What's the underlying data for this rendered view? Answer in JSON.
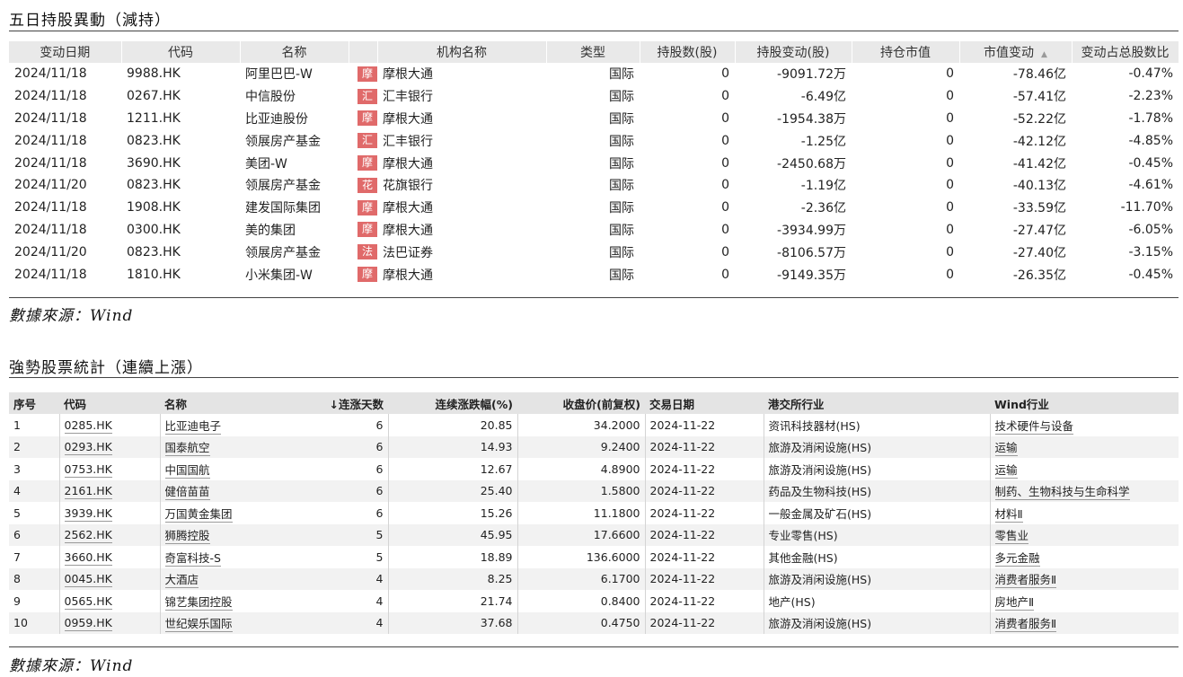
{
  "section1": {
    "title": "五日持股異動（減持）",
    "source": "數據來源：Wind",
    "headers": [
      "变动日期",
      "代码",
      "名称",
      "",
      "机构名称",
      "类型",
      "持股数(股)",
      "持股变动(股)",
      "持仓市值",
      "市值变动",
      "变动占总股数比"
    ],
    "sort_indicator": "▲",
    "rows": [
      {
        "date": "2024/11/18",
        "code": "9988.HK",
        "name": "阿里巴巴-W",
        "badge": "摩",
        "org": "摩根大通",
        "type": "国际",
        "shares": "0",
        "change": "-9091.72万",
        "value": "0",
        "value_change": "-78.46亿",
        "ratio": "-0.47%"
      },
      {
        "date": "2024/11/18",
        "code": "0267.HK",
        "name": "中信股份",
        "badge": "汇",
        "org": "汇丰银行",
        "type": "国际",
        "shares": "0",
        "change": "-6.49亿",
        "value": "0",
        "value_change": "-57.41亿",
        "ratio": "-2.23%"
      },
      {
        "date": "2024/11/18",
        "code": "1211.HK",
        "name": "比亚迪股份",
        "badge": "摩",
        "org": "摩根大通",
        "type": "国际",
        "shares": "0",
        "change": "-1954.38万",
        "value": "0",
        "value_change": "-52.22亿",
        "ratio": "-1.78%"
      },
      {
        "date": "2024/11/18",
        "code": "0823.HK",
        "name": "领展房产基金",
        "badge": "汇",
        "org": "汇丰银行",
        "type": "国际",
        "shares": "0",
        "change": "-1.25亿",
        "value": "0",
        "value_change": "-42.12亿",
        "ratio": "-4.85%"
      },
      {
        "date": "2024/11/18",
        "code": "3690.HK",
        "name": "美团-W",
        "badge": "摩",
        "org": "摩根大通",
        "type": "国际",
        "shares": "0",
        "change": "-2450.68万",
        "value": "0",
        "value_change": "-41.42亿",
        "ratio": "-0.45%"
      },
      {
        "date": "2024/11/20",
        "code": "0823.HK",
        "name": "领展房产基金",
        "badge": "花",
        "org": "花旗银行",
        "type": "国际",
        "shares": "0",
        "change": "-1.19亿",
        "value": "0",
        "value_change": "-40.13亿",
        "ratio": "-4.61%"
      },
      {
        "date": "2024/11/18",
        "code": "1908.HK",
        "name": "建发国际集团",
        "badge": "摩",
        "org": "摩根大通",
        "type": "国际",
        "shares": "0",
        "change": "-2.36亿",
        "value": "0",
        "value_change": "-33.59亿",
        "ratio": "-11.70%"
      },
      {
        "date": "2024/11/18",
        "code": "0300.HK",
        "name": "美的集团",
        "badge": "摩",
        "org": "摩根大通",
        "type": "国际",
        "shares": "0",
        "change": "-3934.99万",
        "value": "0",
        "value_change": "-27.47亿",
        "ratio": "-6.05%"
      },
      {
        "date": "2024/11/20",
        "code": "0823.HK",
        "name": "领展房产基金",
        "badge": "法",
        "org": "法巴证券",
        "type": "国际",
        "shares": "0",
        "change": "-8106.57万",
        "value": "0",
        "value_change": "-27.40亿",
        "ratio": "-3.15%"
      },
      {
        "date": "2024/11/18",
        "code": "1810.HK",
        "name": "小米集团-W",
        "badge": "摩",
        "org": "摩根大通",
        "type": "国际",
        "shares": "0",
        "change": "-9149.35万",
        "value": "0",
        "value_change": "-26.35亿",
        "ratio": "-0.45%"
      }
    ]
  },
  "section2": {
    "title": "強勢股票統計（連續上漲）",
    "source": "數據來源：Wind",
    "headers": [
      "序号",
      "代码",
      "名称",
      "↓连涨天数",
      "连续涨跌幅(%)",
      "收盘价(前复权)",
      "交易日期",
      "港交所行业",
      "Wind行业"
    ],
    "rows": [
      {
        "no": "1",
        "code": "0285.HK",
        "name": "比亚迪电子",
        "days": "6",
        "pct": "20.85",
        "close": "34.2000",
        "date": "2024-11-22",
        "hk_industry": "资讯科技器材(HS)",
        "wind_industry": "技术硬件与设备"
      },
      {
        "no": "2",
        "code": "0293.HK",
        "name": "国泰航空",
        "days": "6",
        "pct": "14.93",
        "close": "9.2400",
        "date": "2024-11-22",
        "hk_industry": "旅游及消闲设施(HS)",
        "wind_industry": "运输"
      },
      {
        "no": "3",
        "code": "0753.HK",
        "name": "中国国航",
        "days": "6",
        "pct": "12.67",
        "close": "4.8900",
        "date": "2024-11-22",
        "hk_industry": "旅游及消闲设施(HS)",
        "wind_industry": "运输"
      },
      {
        "no": "4",
        "code": "2161.HK",
        "name": "健倍苗苗",
        "days": "6",
        "pct": "25.40",
        "close": "1.5800",
        "date": "2024-11-22",
        "hk_industry": "药品及生物科技(HS)",
        "wind_industry": "制药、生物科技与生命科学"
      },
      {
        "no": "5",
        "code": "3939.HK",
        "name": "万国黄金集团",
        "days": "6",
        "pct": "15.26",
        "close": "11.1800",
        "date": "2024-11-22",
        "hk_industry": "一般金属及矿石(HS)",
        "wind_industry": "材料Ⅱ"
      },
      {
        "no": "6",
        "code": "2562.HK",
        "name": "狮腾控股",
        "days": "5",
        "pct": "45.95",
        "close": "17.6600",
        "date": "2024-11-22",
        "hk_industry": "专业零售(HS)",
        "wind_industry": "零售业"
      },
      {
        "no": "7",
        "code": "3660.HK",
        "name": "奇富科技-S",
        "days": "5",
        "pct": "18.89",
        "close": "136.6000",
        "date": "2024-11-22",
        "hk_industry": "其他金融(HS)",
        "wind_industry": "多元金融"
      },
      {
        "no": "8",
        "code": "0045.HK",
        "name": "大酒店",
        "days": "4",
        "pct": "8.25",
        "close": "6.1700",
        "date": "2024-11-22",
        "hk_industry": "旅游及消闲设施(HS)",
        "wind_industry": "消费者服务Ⅱ"
      },
      {
        "no": "9",
        "code": "0565.HK",
        "name": "锦艺集团控股",
        "days": "4",
        "pct": "21.74",
        "close": "0.8400",
        "date": "2024-11-22",
        "hk_industry": "地产(HS)",
        "wind_industry": "房地产Ⅱ"
      },
      {
        "no": "10",
        "code": "0959.HK",
        "name": "世纪娱乐国际",
        "days": "4",
        "pct": "37.68",
        "close": "0.4750",
        "date": "2024-11-22",
        "hk_industry": "旅游及消闲设施(HS)",
        "wind_industry": "消费者服务Ⅱ"
      }
    ]
  }
}
